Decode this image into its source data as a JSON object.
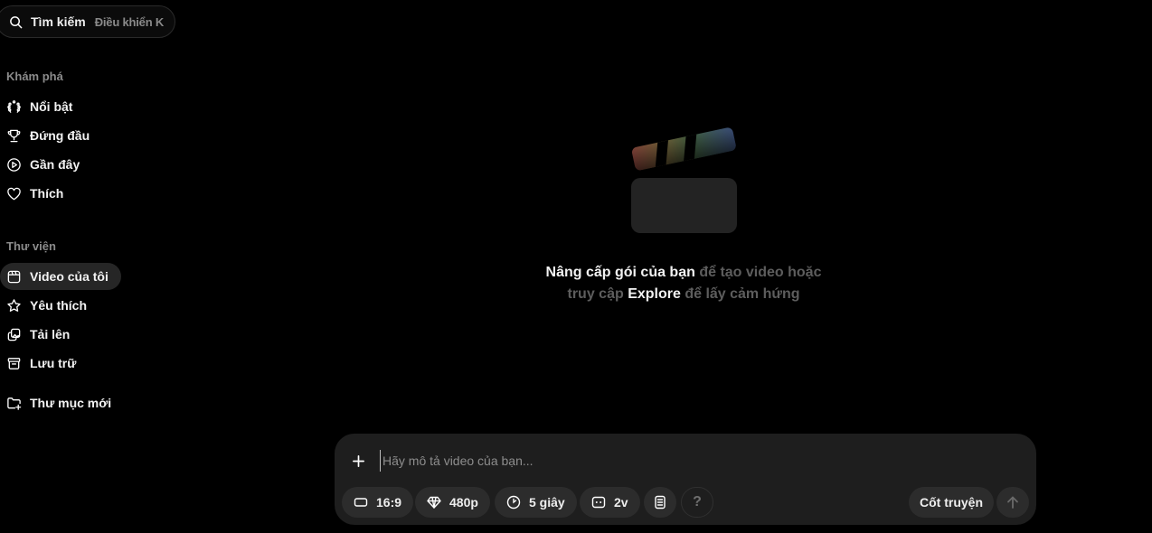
{
  "search": {
    "label": "Tìm kiếm",
    "shortcut": "Điều khiển K"
  },
  "sidebar": {
    "explore_title": "Khám phá",
    "explore_items": [
      {
        "label": "Nổi bật",
        "icon": "laurel-icon"
      },
      {
        "label": "Đứng đầu",
        "icon": "trophy-icon"
      },
      {
        "label": "Gần đây",
        "icon": "play-circle-icon"
      },
      {
        "label": "Thích",
        "icon": "heart-icon"
      }
    ],
    "library_title": "Thư viện",
    "library_items": [
      {
        "label": "Video của tôi",
        "icon": "video-icon",
        "active": true
      },
      {
        "label": "Yêu thích",
        "icon": "star-icon"
      },
      {
        "label": "Tải lên",
        "icon": "upload-image-icon"
      },
      {
        "label": "Lưu trữ",
        "icon": "archive-icon"
      }
    ],
    "new_folder": {
      "label": "Thư mục mới",
      "icon": "folder-plus-icon"
    }
  },
  "empty_state": {
    "icon": "clapperboard-icon",
    "line1_highlight": "Nâng cấp gói của bạn",
    "line1_rest": " để tạo video hoặc",
    "line2_start": "truy cập ",
    "line2_highlight": "Explore",
    "line2_end": " để lấy cảm hứng"
  },
  "composer": {
    "placeholder": "Hãy mô tả video của bạn...",
    "chips": {
      "aspect": "16:9",
      "resolution": "480p",
      "duration": "5 giây",
      "variants": "2v"
    },
    "help": "?",
    "storyboard": "Cốt truyện"
  },
  "colors": {
    "background": "#000000",
    "composer_bg": "#1e1e1e",
    "chip_bg": "#2c2c2c",
    "active_item_bg": "#262626",
    "muted_text": "#8b8b8b"
  }
}
